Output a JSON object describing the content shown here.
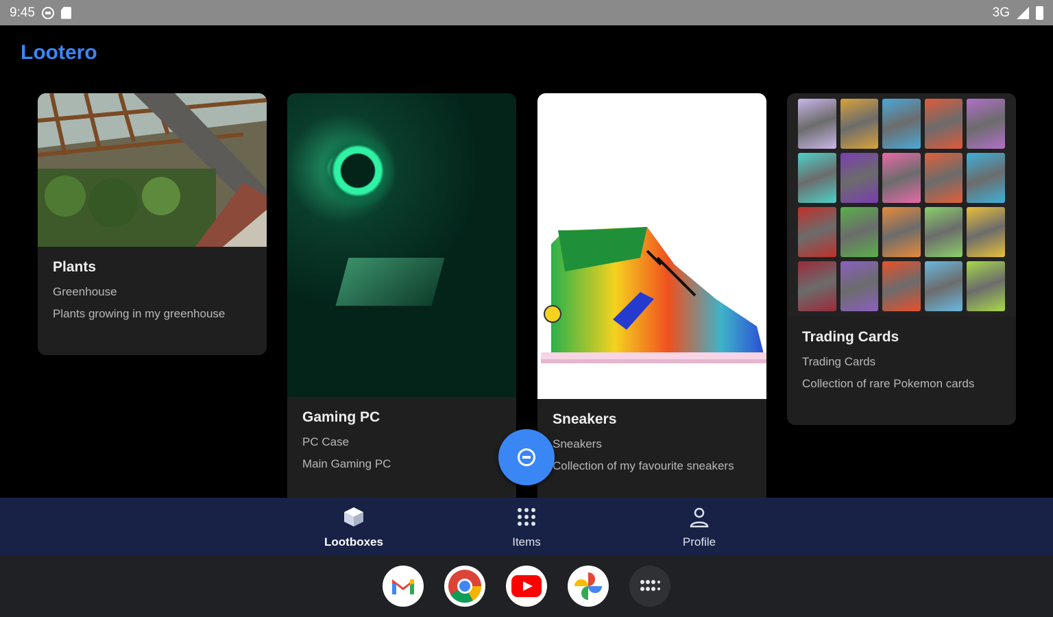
{
  "status_bar": {
    "time": "9:45",
    "network": "3G"
  },
  "app": {
    "title": "Lootero"
  },
  "cards": [
    {
      "title": "Plants",
      "subtitle": "Greenhouse",
      "description": "Plants growing in my greenhouse"
    },
    {
      "title": "Gaming PC",
      "subtitle": "PC Case",
      "description": "Main Gaming PC"
    },
    {
      "title": "Sneakers",
      "subtitle": "Sneakers",
      "description": "Collection of my favourite sneakers"
    },
    {
      "title": "Trading Cards",
      "subtitle": "Trading Cards",
      "description": "Collection of rare Pokemon cards"
    }
  ],
  "bottom_nav": {
    "items": [
      {
        "label": "Lootboxes",
        "icon": "cube-icon",
        "selected": true
      },
      {
        "label": "Items",
        "icon": "grid-icon",
        "selected": false
      },
      {
        "label": "Profile",
        "icon": "person-icon",
        "selected": false
      }
    ]
  },
  "fab": {
    "icon": "remove-circle-icon"
  },
  "dock": {
    "apps": [
      {
        "icon": "gmail-icon"
      },
      {
        "icon": "chrome-icon"
      },
      {
        "icon": "youtube-icon"
      },
      {
        "icon": "photos-icon"
      },
      {
        "icon": "app-drawer-icon"
      }
    ]
  },
  "colors": {
    "accent": "#3b86f5",
    "nav_background": "#182246",
    "card_background": "#1f1f1f"
  }
}
